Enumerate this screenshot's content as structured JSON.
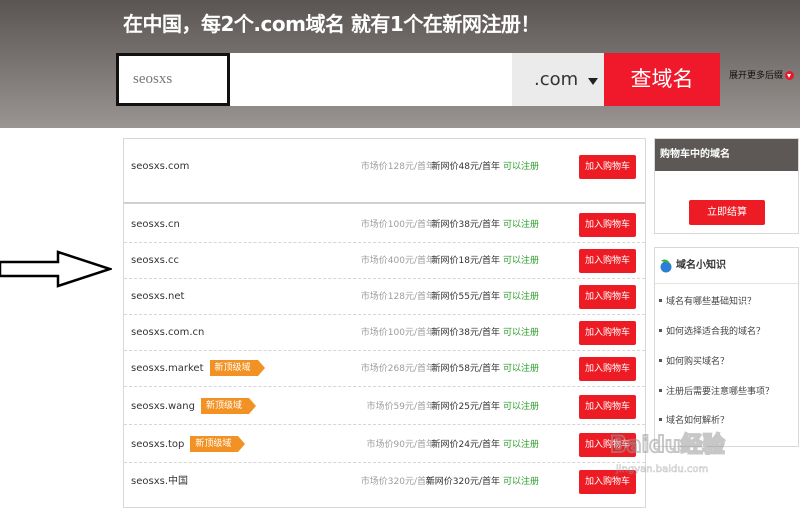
{
  "header": {
    "headline": "在中国，每2个.com域名 就有1个在新网注册！",
    "search_value": "seosxs",
    "tld_selected": ".com",
    "search_button": "查域名",
    "more_suffix": "展开更多后缀"
  },
  "results": {
    "top": {
      "domain": "seosxs.com",
      "market": "市场价128元/首年",
      "price": "新网价48元/首年",
      "status": "可以注册",
      "action": "加入购物车"
    },
    "rows": [
      {
        "domain": "seosxs.cn",
        "tag": "",
        "market": "市场价100元/首年",
        "price": "新网价38元/首年",
        "status": "可以注册",
        "action": "加入购物车"
      },
      {
        "domain": "seosxs.cc",
        "tag": "",
        "market": "市场价400元/首年",
        "price": "新网价18元/首年",
        "status": "可以注册",
        "action": "加入购物车"
      },
      {
        "domain": "seosxs.net",
        "tag": "",
        "market": "市场价128元/首年",
        "price": "新网价55元/首年",
        "status": "可以注册",
        "action": "加入购物车"
      },
      {
        "domain": "seosxs.com.cn",
        "tag": "",
        "market": "市场价100元/首年",
        "price": "新网价38元/首年",
        "status": "可以注册",
        "action": "加入购物车"
      },
      {
        "domain": "seosxs.market",
        "tag": "新顶级域",
        "market": "市场价268元/首年",
        "price": "新网价58元/首年",
        "status": "可以注册",
        "action": "加入购物车"
      },
      {
        "domain": "seosxs.wang",
        "tag": "新顶级域",
        "market": "市场价59元/首年",
        "price": "新网价25元/首年",
        "status": "可以注册",
        "action": "加入购物车"
      },
      {
        "domain": "seosxs.top",
        "tag": "新顶级域",
        "market": "市场价90元/首年",
        "price": "新网价24元/首年",
        "status": "可以注册",
        "action": "加入购物车"
      },
      {
        "domain": "seosxs.中国",
        "tag": "",
        "market": "市场价320元/首年",
        "price": "新网价320元/首年",
        "status": "可以注册",
        "action": "加入购物车"
      }
    ]
  },
  "cart": {
    "title": "购物车中的域名",
    "checkout": "立即结算"
  },
  "knowledge": {
    "title": "域名小知识",
    "items": [
      "域名有哪些基础知识？",
      "如何选择适合我的域名？",
      "如何购买域名？",
      "注册后需要注意哪些事项？",
      "域名如何解析？"
    ]
  },
  "colors": {
    "brand_red": "#ed1c24",
    "available_green": "#2b9a2b",
    "tag_orange": "#f39224",
    "banner_gray": "#76716e"
  },
  "watermark": {
    "text": "Baidu经验",
    "url_text": "jingyan.baidu.com"
  }
}
